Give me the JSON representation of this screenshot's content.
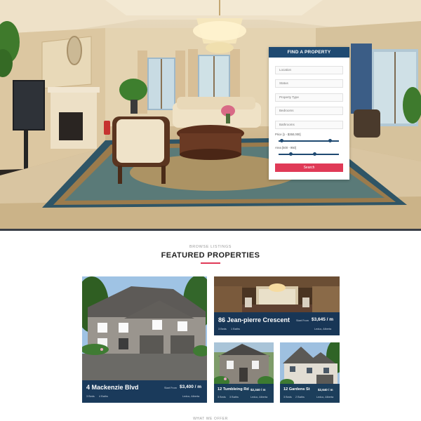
{
  "search": {
    "title": "FIND A PROPERTY",
    "fields": [
      "Location",
      "Status",
      "Property Type",
      "Bedrooms",
      "Bathrooms"
    ],
    "price_label": "Price [1 - $350,000]",
    "price_range": [
      0.05,
      0.85
    ],
    "area_label": "Area [500 - 950]",
    "area_range": [
      0.2,
      0.6
    ],
    "button": "Search"
  },
  "section": {
    "sub": "BROWSE LISTINGS",
    "title": "FEATURED PROPERTIES"
  },
  "properties": [
    {
      "name": "4 Mackenzie Blvd",
      "from": "Start From",
      "price": "$3,400 / m",
      "beds": "3 Beds",
      "baths": "4 Baths",
      "location": "Leduc, Alberta"
    },
    {
      "name": "86 Jean-pierre Crescent",
      "from": "Start From",
      "price": "$3,645 / m",
      "beds": "3 Beds",
      "baths": "1 Baths",
      "location": "Leduc, Alberta"
    },
    {
      "name": "12 Tumbleing Rd",
      "price": "$2,340 / m",
      "beds": "3 Beds",
      "baths": "3 Baths",
      "location": "Leduc, Alberta"
    },
    {
      "name": "12 Gardens St",
      "price": "$2,640 / m",
      "beds": "3 Beds",
      "baths": "2 Baths",
      "location": "Leduc, Alberta"
    }
  ],
  "footer": {
    "sub": "WHAT WE OFFER"
  },
  "colors": {
    "navy": "#1f4a72",
    "accent": "#e03a57"
  }
}
